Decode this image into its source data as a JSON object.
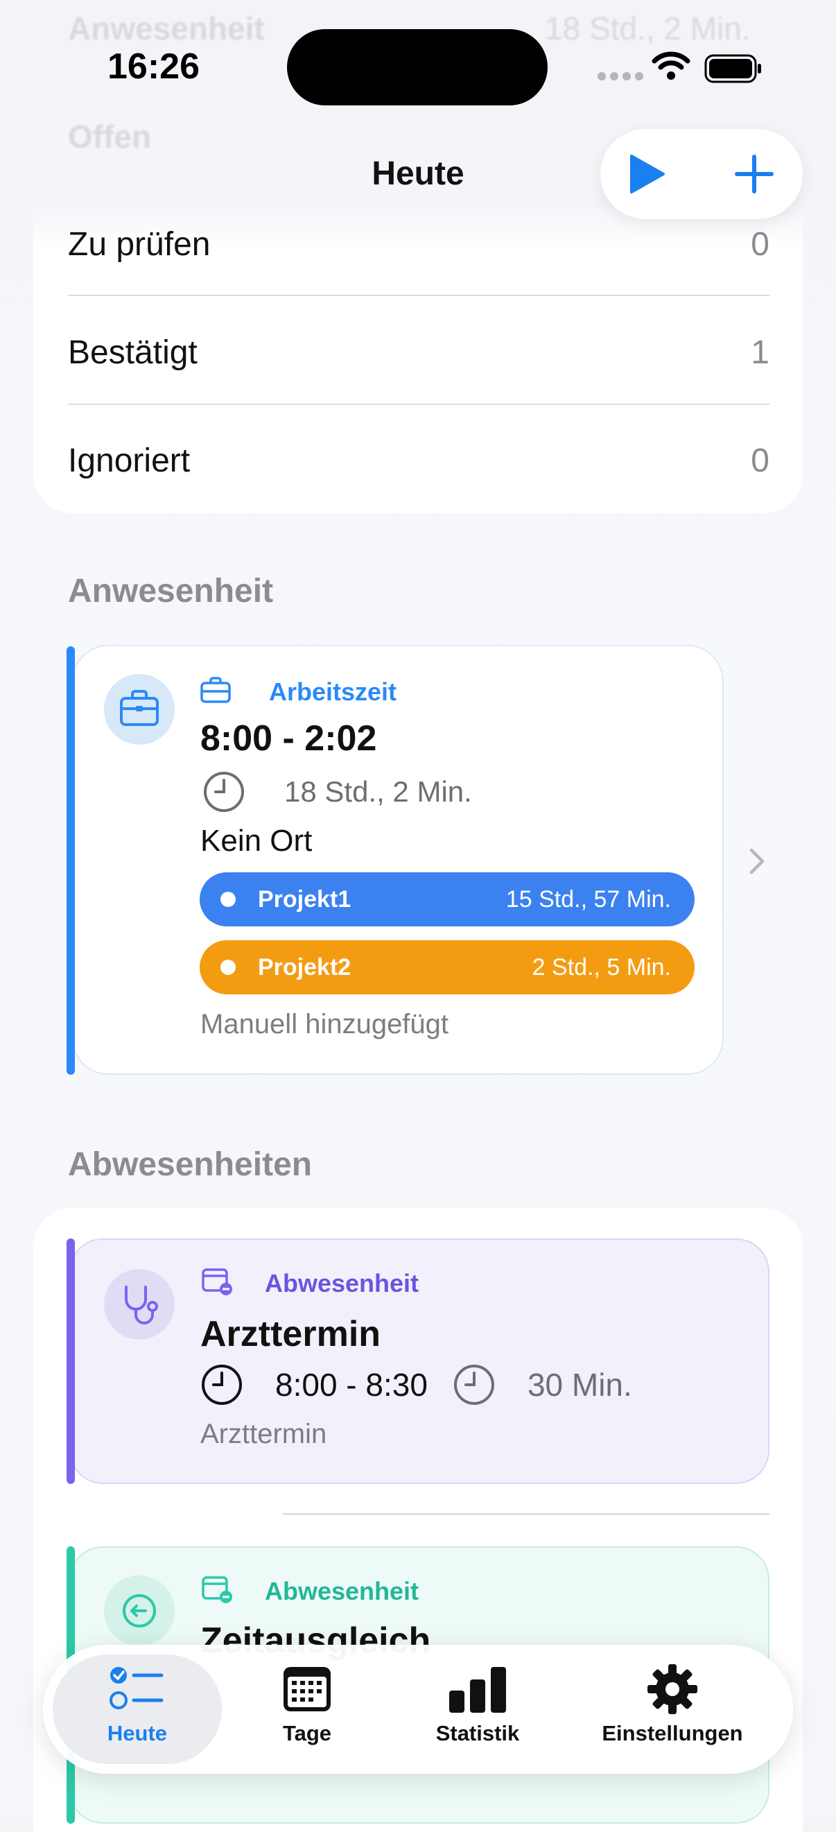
{
  "status_bar": {
    "time": "16:26"
  },
  "background_ghost": {
    "row1_label": "Anwesenheit",
    "row1_value": "18 Std., 2 Min.",
    "row2_label": "Offen"
  },
  "nav": {
    "title": "Heute"
  },
  "summary": [
    {
      "label": "Zu prüfen",
      "value": "0"
    },
    {
      "label": "Bestätigt",
      "value": "1"
    },
    {
      "label": "Ignoriert",
      "value": "0"
    }
  ],
  "attendance": {
    "section_title": "Anwesenheit",
    "type_label": "Arbeitszeit",
    "time_range": "8:00 - 2:02",
    "duration": "18 Std., 2 Min.",
    "place": "Kein Ort",
    "projects": [
      {
        "name": "Projekt1",
        "duration": "15 Std., 57 Min.",
        "color": "#3b82f0"
      },
      {
        "name": "Projekt2",
        "duration": "2 Std., 5 Min.",
        "color": "#f39c12"
      }
    ],
    "note": "Manuell hinzugefügt",
    "accent": "#2a8af6"
  },
  "absences": {
    "section_title": "Abwesenheiten",
    "items": [
      {
        "type_label": "Abwesenheit",
        "title": "Arzttermin",
        "time_range": "8:00 - 8:30",
        "duration": "30 Min.",
        "subtitle": "Arzttermin",
        "accent": "#7a63ee",
        "icon": "stethoscope-icon"
      },
      {
        "type_label": "Abwesenheit",
        "title": "Zeitausgleich",
        "accent": "#2bc9a8",
        "icon": "time-return-icon"
      }
    ]
  },
  "tabbar": {
    "items": [
      {
        "label": "Heute",
        "icon": "checklist-icon",
        "active": true
      },
      {
        "label": "Tage",
        "icon": "calendar-icon",
        "active": false
      },
      {
        "label": "Statistik",
        "icon": "bar-chart-icon",
        "active": false
      },
      {
        "label": "Einstellungen",
        "icon": "gear-icon",
        "active": false
      }
    ]
  }
}
